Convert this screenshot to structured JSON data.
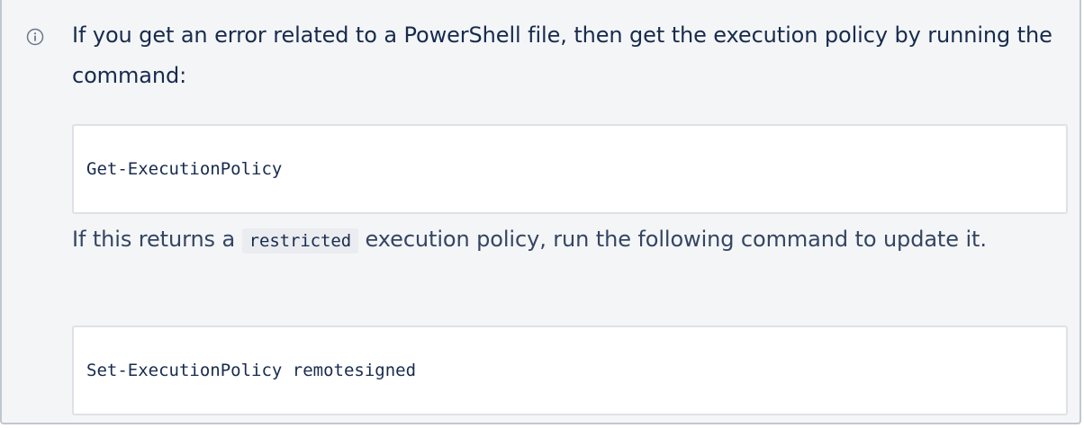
{
  "callout": {
    "icon": "info-icon",
    "intro_text": "If you get an error related to a PowerShell file, then get the execution policy by running the command:",
    "code_1": "Get-ExecutionPolicy",
    "followup_prefix": "If this returns a ",
    "inline_code": "restricted",
    "followup_suffix": " execution policy, run the following command to update it.",
    "code_2": "Set-ExecutionPolicy remotesigned"
  },
  "colors": {
    "panel_background": "#f4f5f7",
    "panel_border": "#c1c7d0",
    "text": "#172b4d",
    "code_background": "#ffffff"
  }
}
